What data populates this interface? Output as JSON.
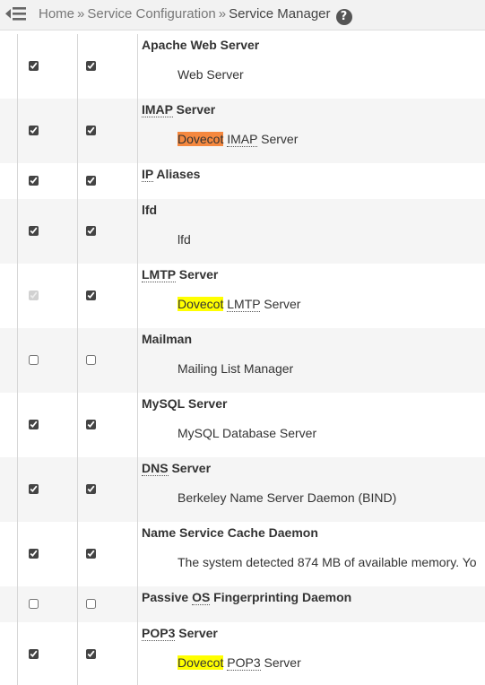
{
  "breadcrumb": {
    "home": "Home",
    "sep": "»",
    "section": "Service Configuration",
    "current": "Service Manager",
    "help": "?"
  },
  "services": [
    {
      "title": "Apache Web Server",
      "enabled": true,
      "monitor": true,
      "enabled_disabled": false,
      "desc": {
        "pre": "",
        "hl": "",
        "abbr": "",
        "post": "Web Server"
      }
    },
    {
      "title_abbr": "IMAP",
      "title_rest": " Server",
      "enabled": true,
      "monitor": true,
      "enabled_disabled": false,
      "desc": {
        "pre": "",
        "hl": "Dovecot",
        "hl_color": "#f5883f",
        "abbr": "IMAP",
        "post": " Server"
      }
    },
    {
      "title_abbr": "IP",
      "title_rest": " Aliases",
      "enabled": true,
      "monitor": true,
      "enabled_disabled": false,
      "desc": null
    },
    {
      "title": "lfd",
      "enabled": true,
      "monitor": true,
      "enabled_disabled": false,
      "desc": {
        "pre": "",
        "hl": "",
        "abbr": "",
        "post": "lfd"
      }
    },
    {
      "title_abbr": "LMTP",
      "title_rest": " Server",
      "enabled": true,
      "monitor": true,
      "enabled_disabled": true,
      "desc": {
        "pre": "",
        "hl": "Dovecot",
        "hl_color": "#ffff00",
        "abbr": "LMTP",
        "post": " Server"
      }
    },
    {
      "title": "Mailman",
      "enabled": false,
      "monitor": false,
      "enabled_disabled": false,
      "desc": {
        "pre": "",
        "hl": "",
        "abbr": "",
        "post": "Mailing List Manager"
      }
    },
    {
      "title": "MySQL Server",
      "enabled": true,
      "monitor": true,
      "enabled_disabled": false,
      "desc": {
        "pre": "",
        "hl": "",
        "abbr": "",
        "post": "MySQL Database Server"
      }
    },
    {
      "title_abbr": "DNS",
      "title_rest": " Server",
      "enabled": true,
      "monitor": true,
      "enabled_disabled": false,
      "desc": {
        "pre": "",
        "hl": "",
        "abbr": "",
        "post": "Berkeley Name Server Daemon (BIND)"
      }
    },
    {
      "title": "Name Service Cache Daemon",
      "enabled": true,
      "monitor": true,
      "enabled_disabled": false,
      "desc": {
        "pre": "",
        "hl": "",
        "abbr": "",
        "post": "The system detected 874 MB of available memory. Yo"
      }
    },
    {
      "title_pre": "Passive ",
      "title_abbr": "OS",
      "title_rest": " Fingerprinting Daemon",
      "enabled": false,
      "monitor": false,
      "enabled_disabled": false,
      "desc": null
    },
    {
      "title_abbr": "POP3",
      "title_rest": " Server",
      "enabled": true,
      "monitor": true,
      "enabled_disabled": false,
      "desc": {
        "pre": "",
        "hl": "Dovecot",
        "hl_color": "#ffff00",
        "abbr": "POP3",
        "post": " Server"
      }
    }
  ],
  "colors": {
    "highlight_yellow": "#ffff00",
    "highlight_orange": "#f5883f",
    "alt_row": "#f5f5f5"
  }
}
